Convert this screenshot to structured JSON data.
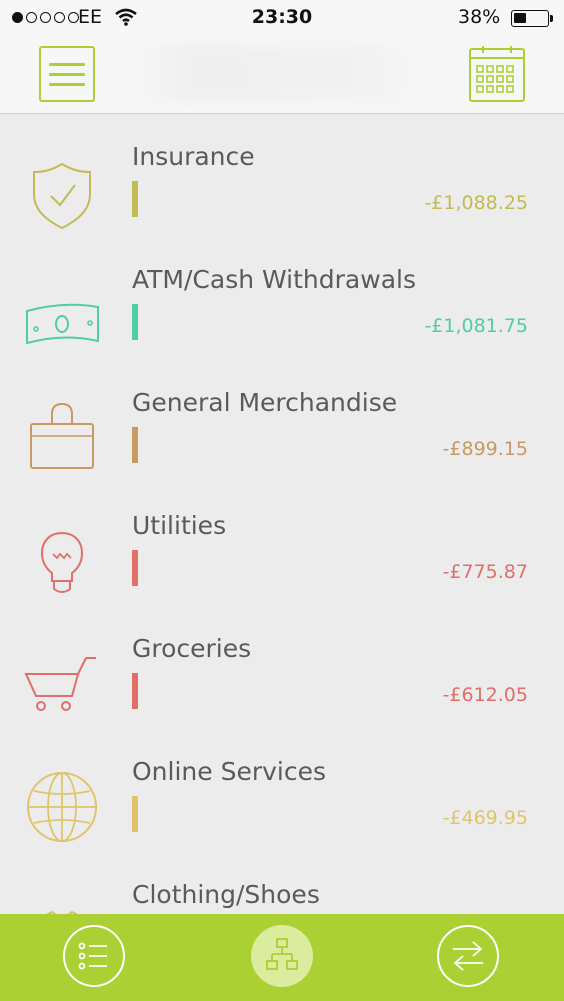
{
  "status_bar": {
    "carrier": "EE",
    "time": "23:30",
    "battery": "38%",
    "battery_level": 0.38,
    "signal_bars": 1
  },
  "header": {
    "menu_icon": "hamburger-icon",
    "calendar_icon": "calendar-icon"
  },
  "categories": [
    {
      "name": "Insurance",
      "amount": "-£1,088.25",
      "color": "#c2bb55",
      "icon": "shield-check-icon"
    },
    {
      "name": "ATM/Cash Withdrawals",
      "amount": "-£1,081.75",
      "color": "#4fcf9f",
      "icon": "banknote-icon"
    },
    {
      "name": "General Merchandise",
      "amount": "-£899.15",
      "color": "#c69a62",
      "icon": "shopping-bag-icon"
    },
    {
      "name": "Utilities",
      "amount": "-£775.87",
      "color": "#e07069",
      "icon": "lightbulb-icon"
    },
    {
      "name": "Groceries",
      "amount": "-£612.05",
      "color": "#e26e6a",
      "icon": "shopping-cart-icon"
    },
    {
      "name": "Online Services",
      "amount": "-£469.95",
      "color": "#e0c46a",
      "icon": "globe-icon"
    },
    {
      "name": "Clothing/Shoes",
      "amount": "",
      "color": "#c9c668",
      "icon": "shirt-icon"
    }
  ],
  "tabbar": {
    "background": "#abd033",
    "tabs": [
      {
        "icon": "list-icon",
        "active": false
      },
      {
        "icon": "hierarchy-icon",
        "active": true
      },
      {
        "icon": "transfer-arrows-icon",
        "active": false
      }
    ]
  }
}
